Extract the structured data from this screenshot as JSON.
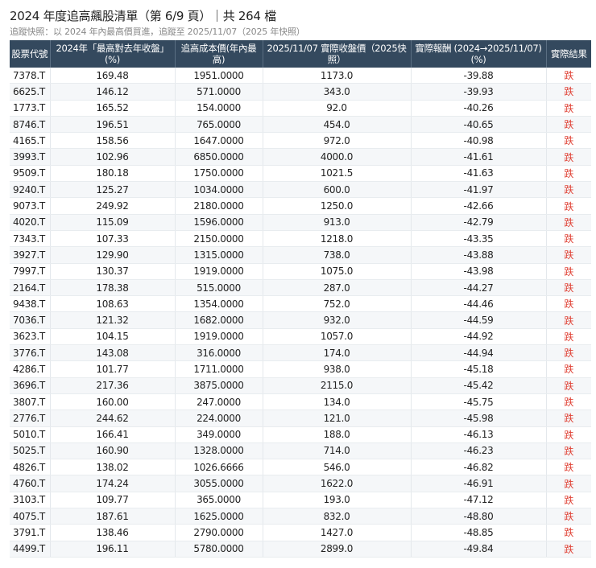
{
  "header": {
    "title": "2024 年度追高飆股清單（第 6/9 頁）｜共 264 檔",
    "subtitle": "追蹤快照：以 2024 年內最高價買進，追蹤至 2025/11/07（2025 年快照）"
  },
  "colors": {
    "header_bg": "#34495e",
    "down": "#e0463a",
    "alt_row": "#f5f7f9"
  },
  "table": {
    "columns": [
      "股票代號",
      "2024年「最高對去年收盤」(%)",
      "追高成本價(年內最高)",
      "2025/11/07 實際收盤價（2025快照）",
      "實際報酬 (2024→2025/11/07) (%)",
      "實際結果"
    ],
    "rows": [
      [
        "7378.T",
        "169.48",
        "1951.0000",
        "1173.0",
        "-39.88",
        "跌"
      ],
      [
        "6625.T",
        "146.12",
        "571.0000",
        "343.0",
        "-39.93",
        "跌"
      ],
      [
        "1773.T",
        "165.52",
        "154.0000",
        "92.0",
        "-40.26",
        "跌"
      ],
      [
        "8746.T",
        "196.51",
        "765.0000",
        "454.0",
        "-40.65",
        "跌"
      ],
      [
        "4165.T",
        "158.56",
        "1647.0000",
        "972.0",
        "-40.98",
        "跌"
      ],
      [
        "3993.T",
        "102.96",
        "6850.0000",
        "4000.0",
        "-41.61",
        "跌"
      ],
      [
        "9509.T",
        "180.18",
        "1750.0000",
        "1021.5",
        "-41.63",
        "跌"
      ],
      [
        "9240.T",
        "125.27",
        "1034.0000",
        "600.0",
        "-41.97",
        "跌"
      ],
      [
        "9073.T",
        "249.92",
        "2180.0000",
        "1250.0",
        "-42.66",
        "跌"
      ],
      [
        "4020.T",
        "115.09",
        "1596.0000",
        "913.0",
        "-42.79",
        "跌"
      ],
      [
        "7343.T",
        "107.33",
        "2150.0000",
        "1218.0",
        "-43.35",
        "跌"
      ],
      [
        "3927.T",
        "129.90",
        "1315.0000",
        "738.0",
        "-43.88",
        "跌"
      ],
      [
        "7997.T",
        "130.37",
        "1919.0000",
        "1075.0",
        "-43.98",
        "跌"
      ],
      [
        "2164.T",
        "178.38",
        "515.0000",
        "287.0",
        "-44.27",
        "跌"
      ],
      [
        "9438.T",
        "108.63",
        "1354.0000",
        "752.0",
        "-44.46",
        "跌"
      ],
      [
        "7036.T",
        "121.32",
        "1682.0000",
        "932.0",
        "-44.59",
        "跌"
      ],
      [
        "3623.T",
        "104.15",
        "1919.0000",
        "1057.0",
        "-44.92",
        "跌"
      ],
      [
        "3776.T",
        "143.08",
        "316.0000",
        "174.0",
        "-44.94",
        "跌"
      ],
      [
        "4286.T",
        "101.77",
        "1711.0000",
        "938.0",
        "-45.18",
        "跌"
      ],
      [
        "3696.T",
        "217.36",
        "3875.0000",
        "2115.0",
        "-45.42",
        "跌"
      ],
      [
        "3807.T",
        "160.00",
        "247.0000",
        "134.0",
        "-45.75",
        "跌"
      ],
      [
        "2776.T",
        "244.62",
        "224.0000",
        "121.0",
        "-45.98",
        "跌"
      ],
      [
        "5010.T",
        "166.41",
        "349.0000",
        "188.0",
        "-46.13",
        "跌"
      ],
      [
        "5025.T",
        "160.90",
        "1328.0000",
        "714.0",
        "-46.23",
        "跌"
      ],
      [
        "4826.T",
        "138.02",
        "1026.6666",
        "546.0",
        "-46.82",
        "跌"
      ],
      [
        "4760.T",
        "174.24",
        "3055.0000",
        "1622.0",
        "-46.91",
        "跌"
      ],
      [
        "3103.T",
        "109.77",
        "365.0000",
        "193.0",
        "-47.12",
        "跌"
      ],
      [
        "4075.T",
        "187.61",
        "1625.0000",
        "832.0",
        "-48.80",
        "跌"
      ],
      [
        "3791.T",
        "138.46",
        "2790.0000",
        "1427.0",
        "-48.85",
        "跌"
      ],
      [
        "4499.T",
        "196.11",
        "5780.0000",
        "2899.0",
        "-49.84",
        "跌"
      ]
    ]
  }
}
